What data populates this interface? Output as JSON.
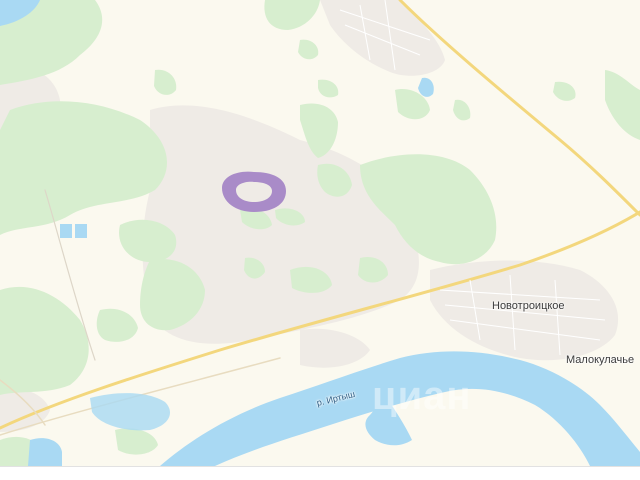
{
  "map": {
    "labels": {
      "village_1": "Новотроицкое",
      "village_2": "Малокулачье",
      "river": "р. Иртыш"
    },
    "watermark": "циан",
    "colors": {
      "land": "#fbf9ef",
      "forest": "#d7eecf",
      "water": "#a9d9f3",
      "road": "#f6df8f",
      "settlement": "#efebe6",
      "highlight": "#a98bc8"
    }
  }
}
